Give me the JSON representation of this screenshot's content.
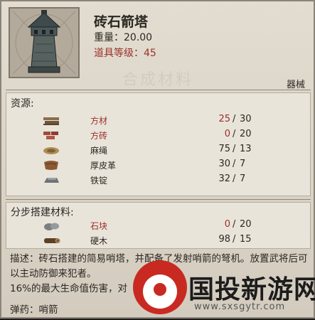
{
  "item": {
    "name": "砖石箭塔",
    "weight_label": "重量：",
    "weight_value": "20.00",
    "level_label": "道具等级：",
    "level_value": "45",
    "category": "器械",
    "watermark_text": "合成材料",
    "icon": "stone-arrow-tower-icon"
  },
  "resources": {
    "title": "资源:",
    "rows": [
      {
        "name": "方材",
        "have": "25",
        "need": "30",
        "insufficient": true,
        "icon": "planks-icon"
      },
      {
        "name": "方砖",
        "have": "0",
        "need": "20",
        "insufficient": true,
        "icon": "bricks-icon"
      },
      {
        "name": "麻绳",
        "have": "75",
        "need": "13",
        "insufficient": false,
        "icon": "rope-icon"
      },
      {
        "name": "厚皮革",
        "have": "30",
        "need": "7",
        "insufficient": false,
        "icon": "leather-icon"
      },
      {
        "name": "铁锭",
        "have": "32",
        "need": "7",
        "insufficient": false,
        "icon": "iron-ingot-icon"
      }
    ]
  },
  "build_materials": {
    "title": "分步搭建材料:",
    "rows": [
      {
        "name": "石块",
        "have": "0",
        "need": "20",
        "insufficient": true,
        "icon": "stone-icon"
      },
      {
        "name": "硬木",
        "have": "98",
        "need": "15",
        "insufficient": false,
        "icon": "hardwood-icon"
      }
    ]
  },
  "description": {
    "text": "描述：砖石搭建的简易哨塔，并配备了发射哨箭的弩机。放置武将后可以主动防御来犯者。",
    "text2": "16%的最大生命值伤害，对",
    "ammo_label": "弹药：",
    "ammo_value": "哨箭"
  },
  "watermark": {
    "brand": "国投新游网",
    "url": "www.sxsgytr.com"
  },
  "colors": {
    "insufficient": "#9b2f2a",
    "text": "#2b2722",
    "logo_red": "#c82a22"
  }
}
